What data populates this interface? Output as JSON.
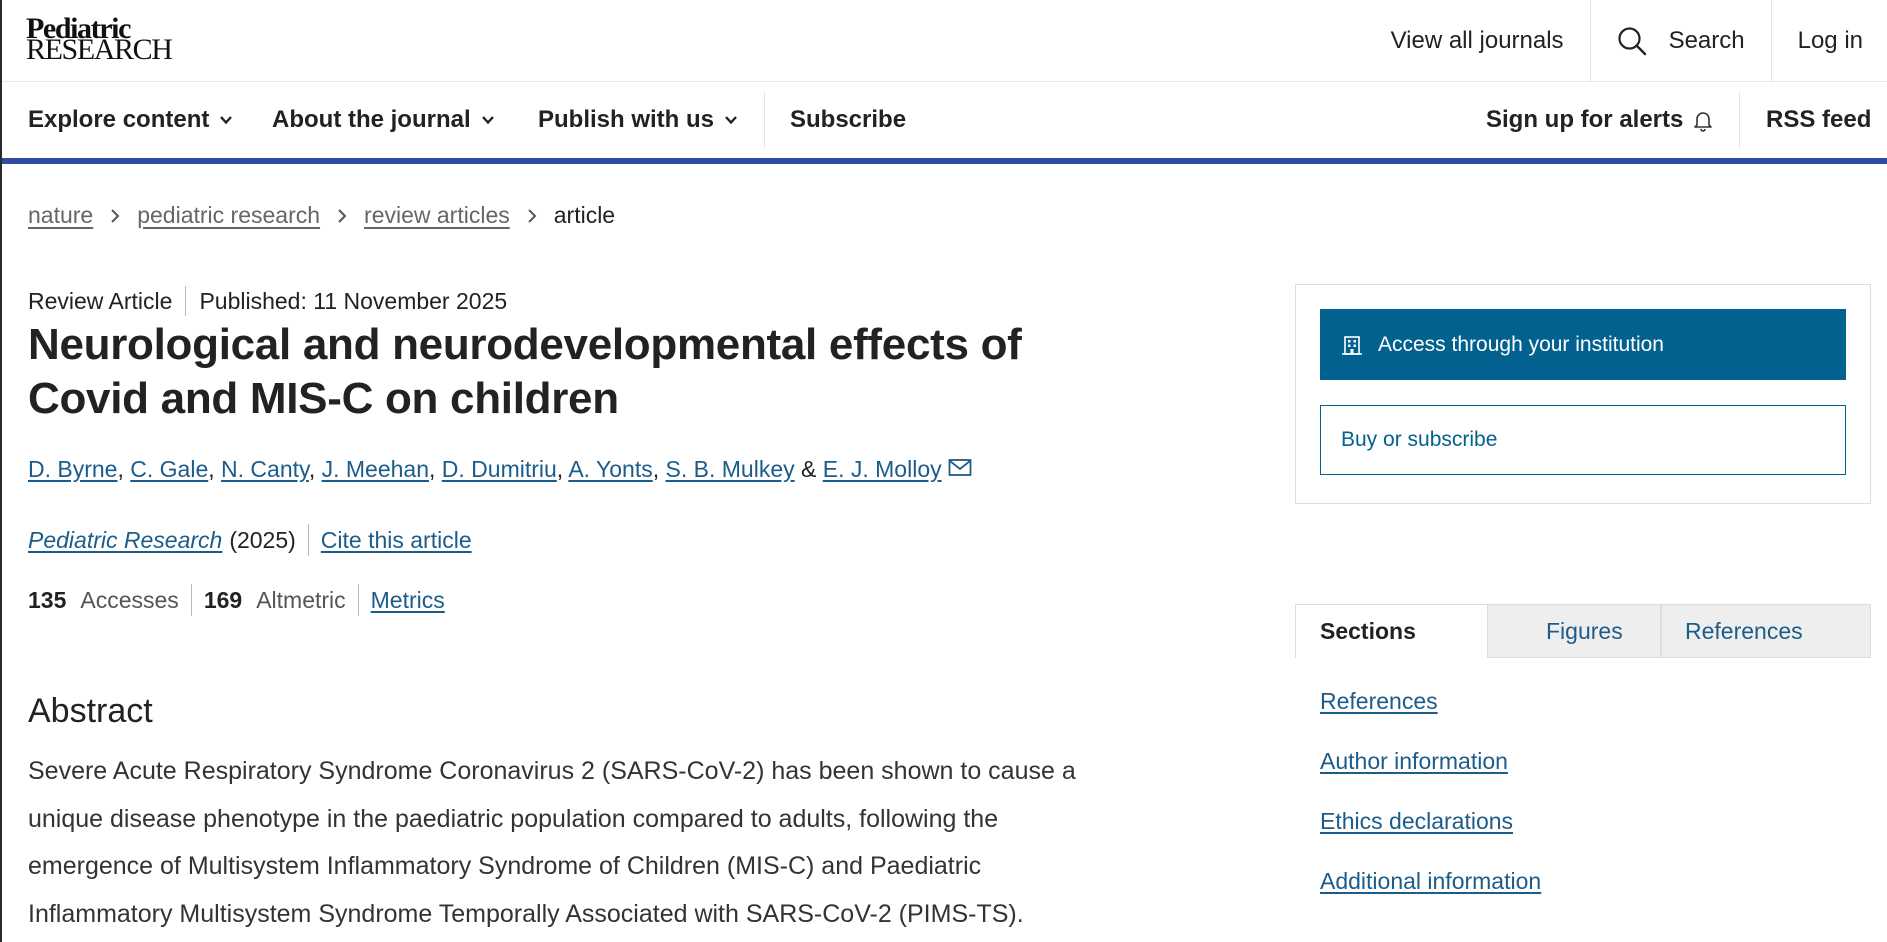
{
  "logo": {
    "line1": "Pediatric",
    "line2": "RESEARCH"
  },
  "top_nav": {
    "view_all": "View all journals",
    "search": "Search",
    "login": "Log in"
  },
  "main_nav": {
    "explore": "Explore content",
    "about": "About the journal",
    "publish": "Publish with us",
    "subscribe": "Subscribe",
    "alerts": "Sign up for alerts",
    "rss": "RSS feed"
  },
  "breadcrumb": [
    "nature",
    "pediatric research",
    "review articles",
    "article"
  ],
  "article": {
    "type": "Review Article",
    "published": "Published: 11 November 2025",
    "title": "Neurological and neurodevelopmental effects of Covid and MIS-C on children",
    "authors": [
      "D. Byrne",
      "C. Gale",
      "N. Canty",
      "J. Meehan",
      "D. Dumitriu",
      "A. Yonts",
      "S. B. Mulkey",
      "E. J. Molloy"
    ],
    "author_sep": ", ",
    "author_amp": " & ",
    "journal": "Pediatric Research",
    "year": "(2025)",
    "cite": "Cite this article",
    "accesses_value": "135",
    "accesses_label": "Accesses",
    "altmetric_value": "169",
    "altmetric_label": "Altmetric",
    "metrics_link": "Metrics"
  },
  "abstract": {
    "heading": "Abstract",
    "lines": [
      "Severe Acute Respiratory Syndrome Coronavirus 2 (SARS-CoV-2) has been shown to cause a",
      "unique disease phenotype in the paediatric population compared to adults, following the",
      "emergence of Multisystem Inflammatory Syndrome of Children (MIS-C) and Paediatric",
      "Inflammatory Multisystem Syndrome Temporally Associated with SARS-CoV-2 (PIMS-TS)."
    ]
  },
  "sidebar": {
    "access_label": "Access through your institution",
    "buy_label": "Buy or subscribe",
    "tabs": [
      "Sections",
      "Figures",
      "References"
    ],
    "links": [
      "References",
      "Author information",
      "Ethics declarations",
      "Additional information"
    ]
  },
  "colors": {
    "link": "#1c5c8b",
    "accent_bar": "#2e4da0",
    "button": "#03618f"
  }
}
